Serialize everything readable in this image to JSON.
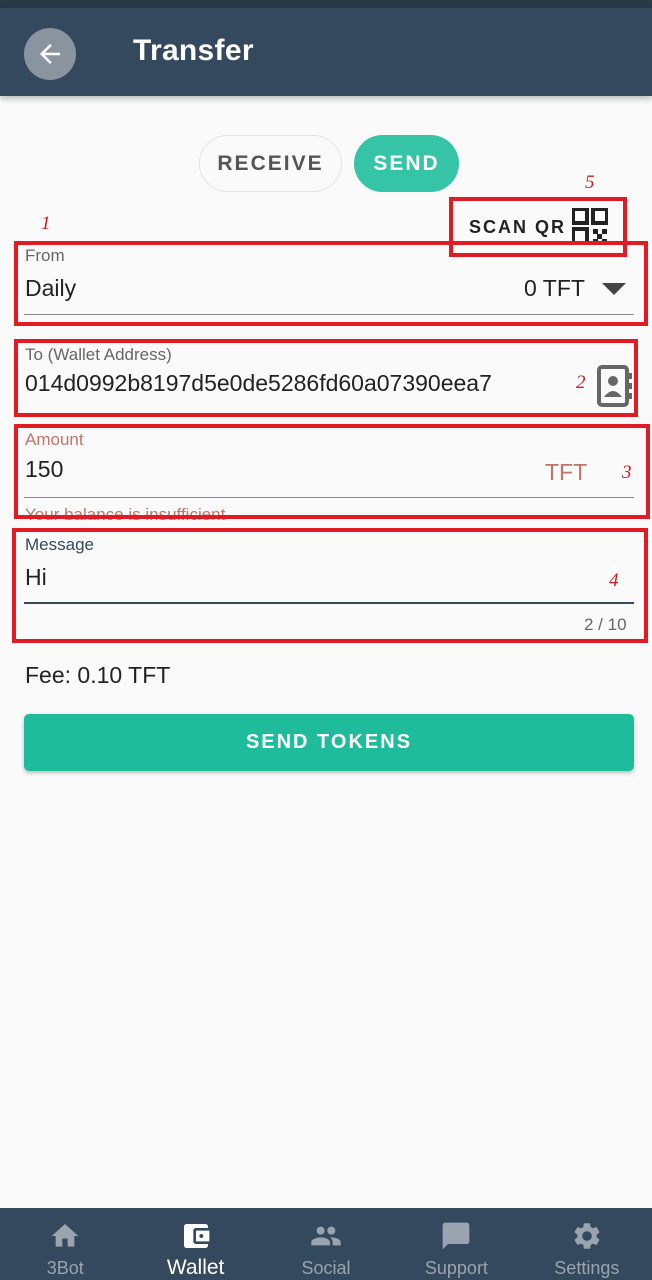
{
  "appbar": {
    "title": "Transfer",
    "back_icon": "arrow-left-icon"
  },
  "toggle": {
    "receive_label": "RECEIVE",
    "send_label": "SEND"
  },
  "scan_qr": {
    "label": "SCAN QR",
    "icon": "qr-code-icon"
  },
  "annotations": [
    "1",
    "2",
    "3",
    "4",
    "5"
  ],
  "from": {
    "label": "From",
    "wallet": "Daily",
    "balance": "0 TFT"
  },
  "to": {
    "label": "To (Wallet Address)",
    "value": "014d0992b8197d5e0de5286fd60a07390eea7",
    "icon": "contacts-book-icon"
  },
  "amount": {
    "label": "Amount",
    "value": "150",
    "unit": "TFT",
    "error": "Your balance is insufficient"
  },
  "message": {
    "label": "Message",
    "value": "Hi",
    "counter": "2 / 10"
  },
  "fee": "Fee: 0.10 TFT",
  "send_button": "SEND TOKENS",
  "nav": [
    {
      "label": "3Bot",
      "icon": "home-icon"
    },
    {
      "label": "Wallet",
      "icon": "wallet-icon"
    },
    {
      "label": "Social",
      "icon": "people-icon"
    },
    {
      "label": "Support",
      "icon": "chat-icon"
    },
    {
      "label": "Settings",
      "icon": "gear-icon"
    }
  ],
  "colors": {
    "appbar": "#34495e",
    "accent": "#1fbc9c",
    "error": "#c0756a",
    "annotation": "#e01b24"
  }
}
